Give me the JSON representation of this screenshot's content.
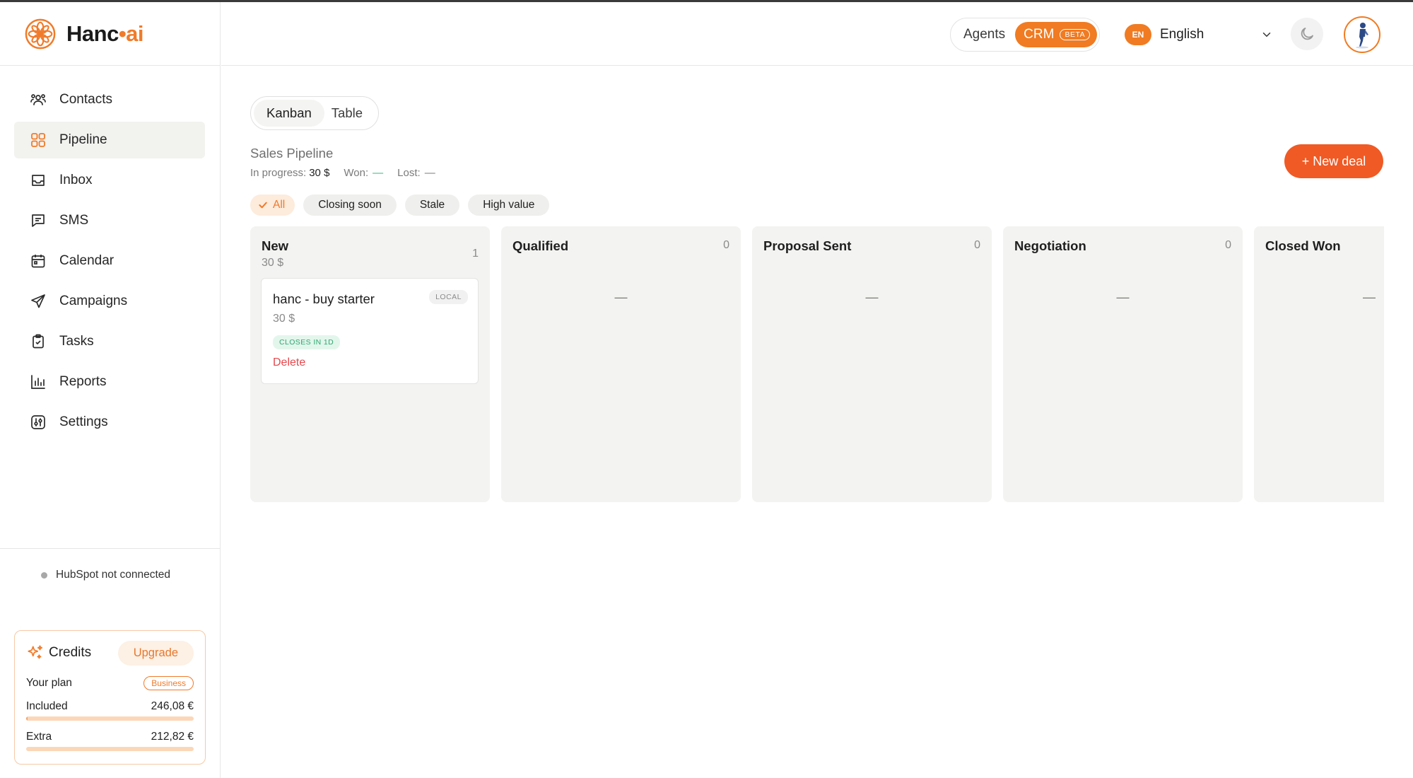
{
  "brand": {
    "name": "Hanc",
    "dot": "•",
    "suffix": "ai",
    "accent": "#f07b2a"
  },
  "sidebar": {
    "items": [
      {
        "label": "Contacts",
        "icon": "contacts-icon"
      },
      {
        "label": "Pipeline",
        "icon": "pipeline-icon",
        "active": true
      },
      {
        "label": "Inbox",
        "icon": "inbox-icon"
      },
      {
        "label": "SMS",
        "icon": "sms-icon"
      },
      {
        "label": "Calendar",
        "icon": "calendar-icon"
      },
      {
        "label": "Campaigns",
        "icon": "campaigns-icon"
      },
      {
        "label": "Tasks",
        "icon": "tasks-icon"
      },
      {
        "label": "Reports",
        "icon": "reports-icon"
      },
      {
        "label": "Settings",
        "icon": "settings-icon"
      }
    ],
    "hubspot_status": "HubSpot not connected"
  },
  "credits": {
    "title": "Credits",
    "upgrade_label": "Upgrade",
    "plan_label": "Your plan",
    "plan_value": "Business",
    "included_label": "Included",
    "included_value": "246,08 €",
    "included_progress": 0.01,
    "extra_label": "Extra",
    "extra_value": "212,82 €",
    "extra_progress": 0.0
  },
  "header": {
    "mode_agents": "Agents",
    "mode_crm": "CRM",
    "beta_label": "BETA",
    "lang_code": "EN",
    "lang_name": "English"
  },
  "main": {
    "view_tabs": {
      "kanban": "Kanban",
      "table": "Table"
    },
    "pipeline_title": "Sales Pipeline",
    "stats": {
      "in_progress_label": "In progress:",
      "in_progress_value": "30 $",
      "won_label": "Won:",
      "won_value": "—",
      "lost_label": "Lost:",
      "lost_value": "—"
    },
    "new_deal_label": "+ New deal",
    "filters": [
      "All",
      "Closing soon",
      "Stale",
      "High value"
    ],
    "columns": [
      {
        "title": "New",
        "count": "1",
        "sum": "30 $"
      },
      {
        "title": "Qualified",
        "count": "0",
        "empty": "—"
      },
      {
        "title": "Proposal Sent",
        "count": "0",
        "empty": "—"
      },
      {
        "title": "Negotiation",
        "count": "0",
        "empty": "—"
      },
      {
        "title": "Closed Won",
        "count": "",
        "empty": "—"
      }
    ],
    "card": {
      "title": "hanc - buy starter",
      "badge": "LOCAL",
      "amount": "30 $",
      "closes": "CLOSES IN 1D",
      "delete_label": "Delete"
    }
  }
}
